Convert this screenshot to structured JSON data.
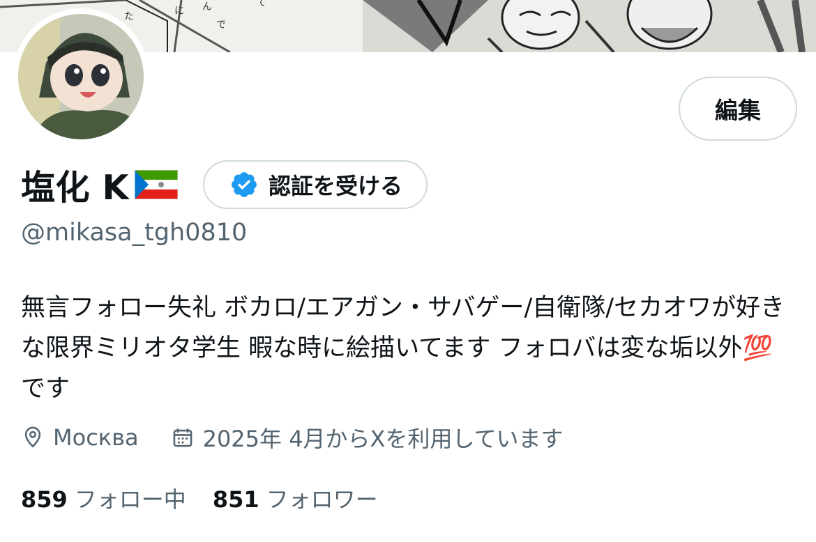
{
  "banner": {
    "icon": "manga-illustration"
  },
  "avatar": {
    "icon": "anime-character-avatar"
  },
  "edit_button": {
    "label": "編集"
  },
  "profile": {
    "display_name": "塩化 K",
    "flag_icon": "equatorial-guinea-flag-emoji",
    "handle": "@mikasa_tgh0810",
    "bio_text": "無言フォロー失礼 ボカロ/エアガン・サバゲー/自衛隊/セカオワが好きな限界ミリオタ学生 暇な時に絵描いてます フォロバは変な垢以外",
    "bio_emoji": "💯",
    "bio_suffix": " です"
  },
  "verify_button": {
    "label": "認証を受ける",
    "icon": "verified-badge-icon",
    "accent": "#1d9bf0"
  },
  "meta": {
    "location": "Москва",
    "location_icon": "location-pin-icon",
    "joined": "2025年 4月からXを利用しています",
    "joined_icon": "calendar-icon"
  },
  "stats": {
    "following_count": "859",
    "following_label": "フォロー中",
    "followers_count": "851",
    "followers_label": "フォロワー"
  },
  "colors": {
    "text": "#0f1419",
    "secondary": "#536471",
    "border": "#cfd9de"
  }
}
